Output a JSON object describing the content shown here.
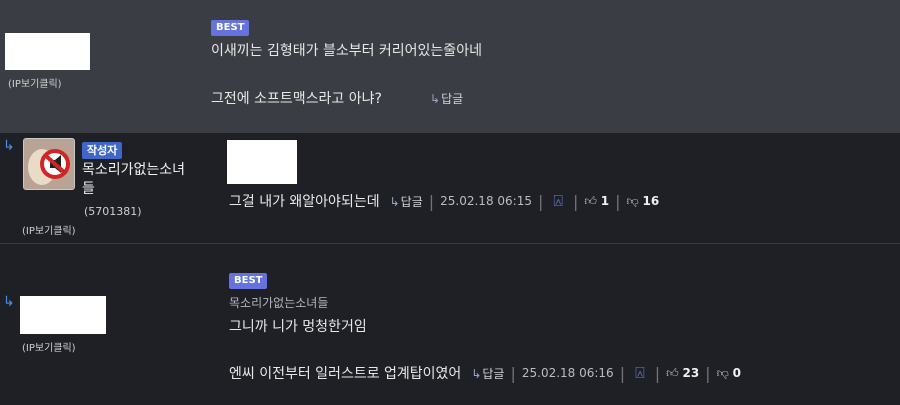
{
  "comments": [
    {
      "ip_label": "(IP보기클릭)",
      "badge": "BEST",
      "lines": [
        "이새끼는 김형태가 블소부터 커리어있는줄아네",
        "그전에 소프트맥스라고 아냐?"
      ],
      "reply_label": "답글"
    },
    {
      "author_badge": "작성자",
      "author": "목소리가없는소녀들",
      "user_id": "(5701381)",
      "ip_label": "(IP보기클릭)",
      "lines": [
        "그걸 내가 왜알아야되는데"
      ],
      "reply_label": "답글",
      "date": "25.02.18 06:15",
      "likes": "1",
      "dislikes": "16"
    },
    {
      "ip_label": "(IP보기클릭)",
      "badge": "BEST",
      "reply_to": "목소리가없는소녀들",
      "lines": [
        "그니까 니가 멍청한거임",
        "엔씨 이전부터 일러스트로 업계탑이였어"
      ],
      "reply_label": "답글",
      "date": "25.02.18 06:16",
      "likes": "23",
      "dislikes": "0"
    }
  ],
  "icons": {
    "reply_arrow": "reply-arrow-icon",
    "thumbs_up": "thumbs-up-icon",
    "thumbs_down": "thumbs-down-icon",
    "report": "bell-icon"
  },
  "colors": {
    "best_badge": "#6673dc",
    "author_badge": "#3f67c8",
    "highlight_bg": "#3a3d43",
    "bg": "#1e2026"
  }
}
